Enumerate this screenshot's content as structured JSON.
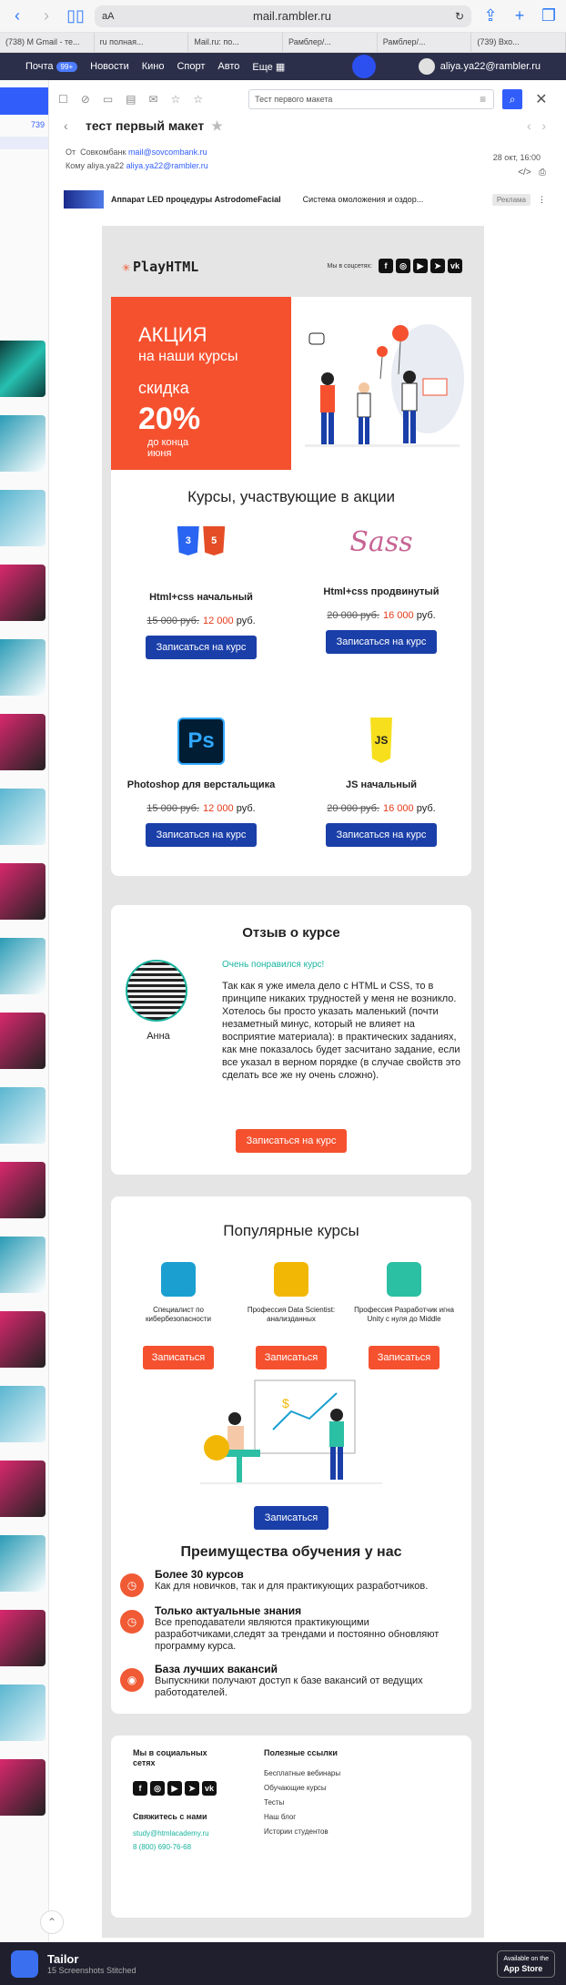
{
  "browser": {
    "aa": "aA",
    "url": "mail.rambler.ru",
    "tabs": [
      "(738) M Gmail - те...",
      "ru полная...",
      "Mail.ru: по...",
      "Рамблер/...",
      "Рамблер/...",
      "(739) Вхо..."
    ]
  },
  "rambler_nav": {
    "items": [
      "Почта",
      "Новости",
      "Кино",
      "Спорт",
      "Авто",
      "Еще"
    ],
    "mail_badge": "99+",
    "user": "aliya.ya22@rambler.ru"
  },
  "sidebar": {
    "count": "739"
  },
  "toolbar": {
    "search_placeholder": "Тест первого макета"
  },
  "mail": {
    "subject": "тест первый макет",
    "from_label": "От",
    "from_name": "Совкомбанк",
    "from_email": "mail@sovcombank.ru",
    "to_label": "Кому",
    "to_name": "aliya.ya22",
    "to_email": "aliya.ya22@rambler.ru",
    "date": "28 окт, 16:00",
    "ad_title": "Аппарат LED процедуры AstrodomeFacial",
    "ad_desc": "Система омоложения и оздор...",
    "ad_tag": "Реклама"
  },
  "newsletter": {
    "logo": "PlayHTML",
    "social_label": "Мы в соцсетях:",
    "hero": {
      "line1": "АКЦИЯ",
      "line2": "на наши курсы",
      "line3": "скидка",
      "percent": "20%",
      "until": "до конца июня"
    },
    "courses_title": "Курсы, участвующие в акции",
    "courses": [
      {
        "title": "Html+css начальный",
        "old": "15 000 руб.",
        "new": "12 000",
        "cur": "руб.",
        "btn": "Записаться на курс"
      },
      {
        "title": "Html+css продвинутый",
        "old": "20 000 руб.",
        "new": "16 000",
        "cur": "руб.",
        "btn": "Записаться на курс"
      },
      {
        "title": "Photoshop для верстальщика",
        "old": "15 000 руб.",
        "new": "12 000",
        "cur": "руб.",
        "btn": "Записаться на курс"
      },
      {
        "title": "JS начальный",
        "old": "20 000 руб.",
        "new": "16 000",
        "cur": "руб.",
        "btn": "Записаться на курс"
      }
    ],
    "review": {
      "title": "Отзыв о курсе",
      "name": "Анна",
      "headline": "Очень понравился курс!",
      "text": "Так как я уже имела дело с HTML и CSS, то в принципе никаких трудностей у меня не возникло. Хотелось бы просто указать маленький (почти незаметный минус, который не влияет на восприятие материала): в практических заданиях, как мне показалось будет засчитано задание, если все указал в верном порядке (в случае свойств это сделать все же ну очень сложно).",
      "btn": "Записаться на курс"
    },
    "popular": {
      "title": "Популярные курсы",
      "items": [
        {
          "title": "Специалист по кибербезопасности",
          "btn": "Записаться"
        },
        {
          "title": "Профессия Data Scientist: анализданных",
          "btn": "Записаться"
        },
        {
          "title": "Профессия Разработчик игна Unity с нуля до Middle",
          "btn": "Записаться"
        }
      ],
      "btn_main": "Записаться"
    },
    "advantages": {
      "title": "Преимущества обучения у нас",
      "items": [
        {
          "h": "Более 30 курсов",
          "t": "Как для новичков, так и для практикующих разработчиков."
        },
        {
          "h": "Только актуальные знания",
          "t": "Все преподаватели являются практикующими разработчиками,следят за трендами и постоянно обновляют программу курса."
        },
        {
          "h": "База лучших вакансий",
          "t": "Выпускники получают доступ к базе вакансий от ведущих работодателей."
        }
      ]
    },
    "footer": {
      "social": "Мы в социальных сетях",
      "contact": "Свяжитесь с нами",
      "email": "study@htmlacademy.ru",
      "phone": "8 (800) 690-76-68",
      "links_title": "Полезные ссылки",
      "links": [
        "Бесплатные вебинары",
        "Обучающие курсы",
        "Тесты",
        "Наш блог",
        "Истории студентов"
      ]
    }
  },
  "tailor": {
    "title": "Tailor",
    "sub": "15 Screenshots Stitched",
    "store_small": "Available on the",
    "store": "App Store"
  },
  "colors": {
    "accent": "#f5512f",
    "blue": "#1a3fa8",
    "green": "#19b39e"
  }
}
